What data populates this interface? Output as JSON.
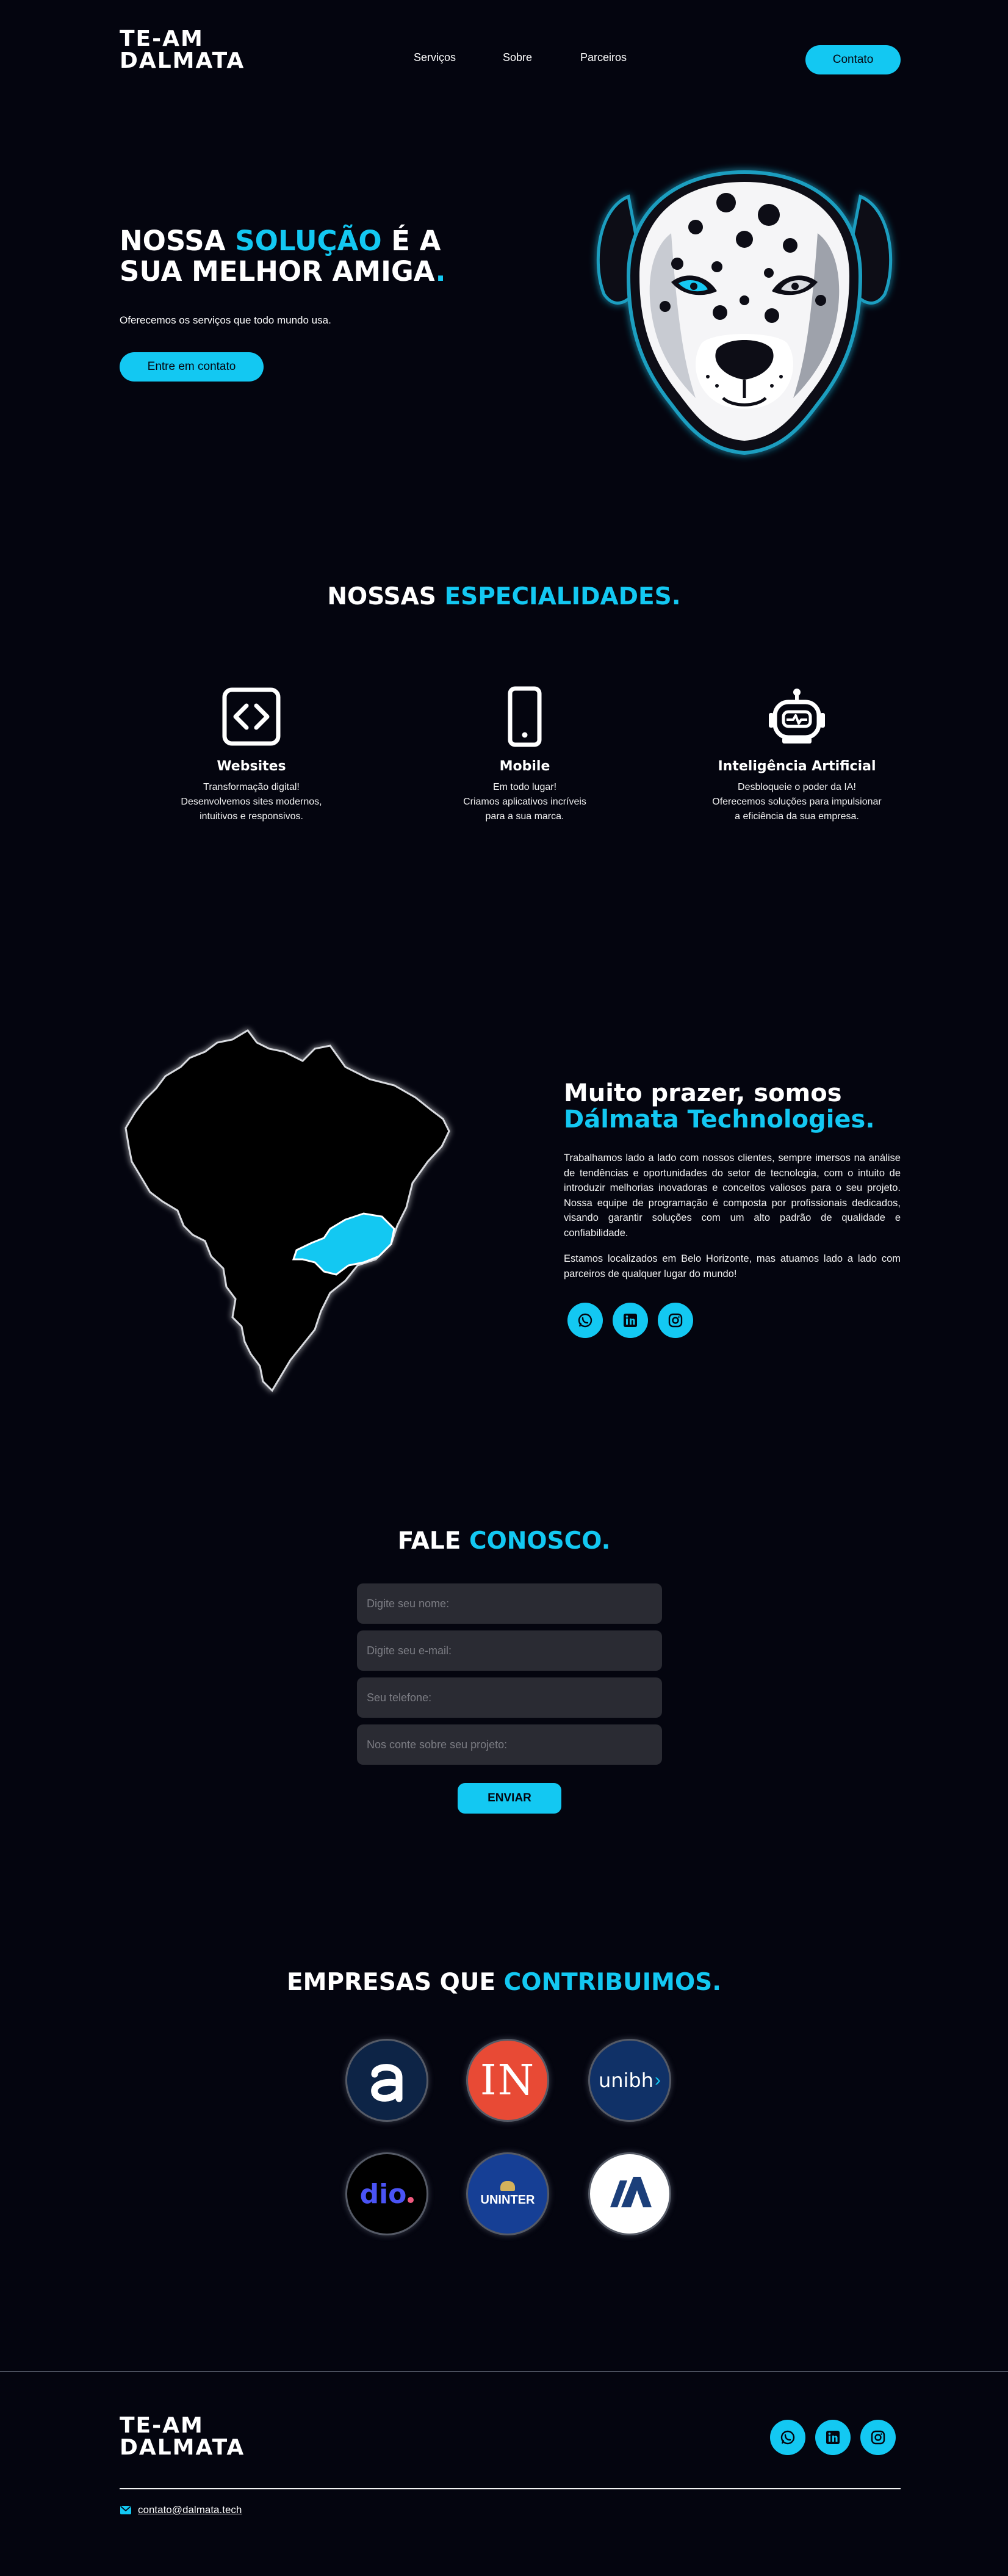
{
  "header": {
    "logo_line1": "TE-AM",
    "logo_line2": "DALMATA",
    "nav": [
      "Serviços",
      "Sobre",
      "Parceiros"
    ],
    "contact_button": "Contato"
  },
  "hero": {
    "title_part1": "NOSSA ",
    "title_accent": "SOLUÇÃO",
    "title_part2": " É A SUA MELHOR AMIGA",
    "title_dot": ".",
    "subtitle": "Oferecemos os serviços que todo mundo usa.",
    "cta": "Entre em contato"
  },
  "specialties": {
    "title_part1": "NOSSAS ",
    "title_accent": "ESPECIALIDADES.",
    "items": [
      {
        "icon": "code-icon",
        "title": "Websites",
        "line1": "Transformação digital!",
        "line2": "Desenvolvemos sites modernos,",
        "line3": "intuitivos e responsivos."
      },
      {
        "icon": "smartphone-icon",
        "title": "Mobile",
        "line1": "Em todo lugar!",
        "line2": "Criamos aplicativos incríveis",
        "line3": "para a sua marca."
      },
      {
        "icon": "robot-icon",
        "title": "Inteligência Artificial",
        "line1": "Desbloqueie o poder da IA!",
        "line2": "Oferecemos soluções para impulsionar",
        "line3": "a eficiência da sua empresa."
      }
    ]
  },
  "about": {
    "title_part1": "Muito prazer, somos",
    "title_accent": "Dálmata Technologies.",
    "paragraph1": "Trabalhamos lado a lado com nossos clientes, sempre imersos na análise de tendências e oportunidades do setor de tecnologia, com o intuito de introduzir melhorias inovadoras e conceitos valiosos para o seu projeto. Nossa equipe de programação é composta por profissionais dedicados, visando garantir soluções com um alto padrão de qualidade e confiabilidade.",
    "paragraph2": "Estamos localizados em Belo Horizonte, mas atuamos lado a lado com parceiros de qualquer lugar do mundo!",
    "socials": [
      "whatsapp-icon",
      "linkedin-icon",
      "instagram-icon"
    ]
  },
  "contact": {
    "title_part1": "FALE ",
    "title_accent": "CONOSCO.",
    "name_placeholder": "Digite seu nome:",
    "email_placeholder": "Digite seu e-mail:",
    "phone_placeholder": "Seu telefone:",
    "project_placeholder": "Nos conte sobre seu projeto:",
    "submit": "ENVIAR"
  },
  "partners": {
    "title_part1": "EMPRESAS QUE ",
    "title_accent": "CONTRIBUIMOS.",
    "logo_in": "IN",
    "logo_unibh": "unibh",
    "logo_dio": "dio",
    "logo_uninter": "UNINTER"
  },
  "footer": {
    "logo_line1": "TE-AM",
    "logo_line2": "DALMATA",
    "email": "contato@dalmata.tech"
  },
  "colors": {
    "background": "#04050f",
    "accent": "#13c8f2",
    "field": "#2a2b33"
  }
}
